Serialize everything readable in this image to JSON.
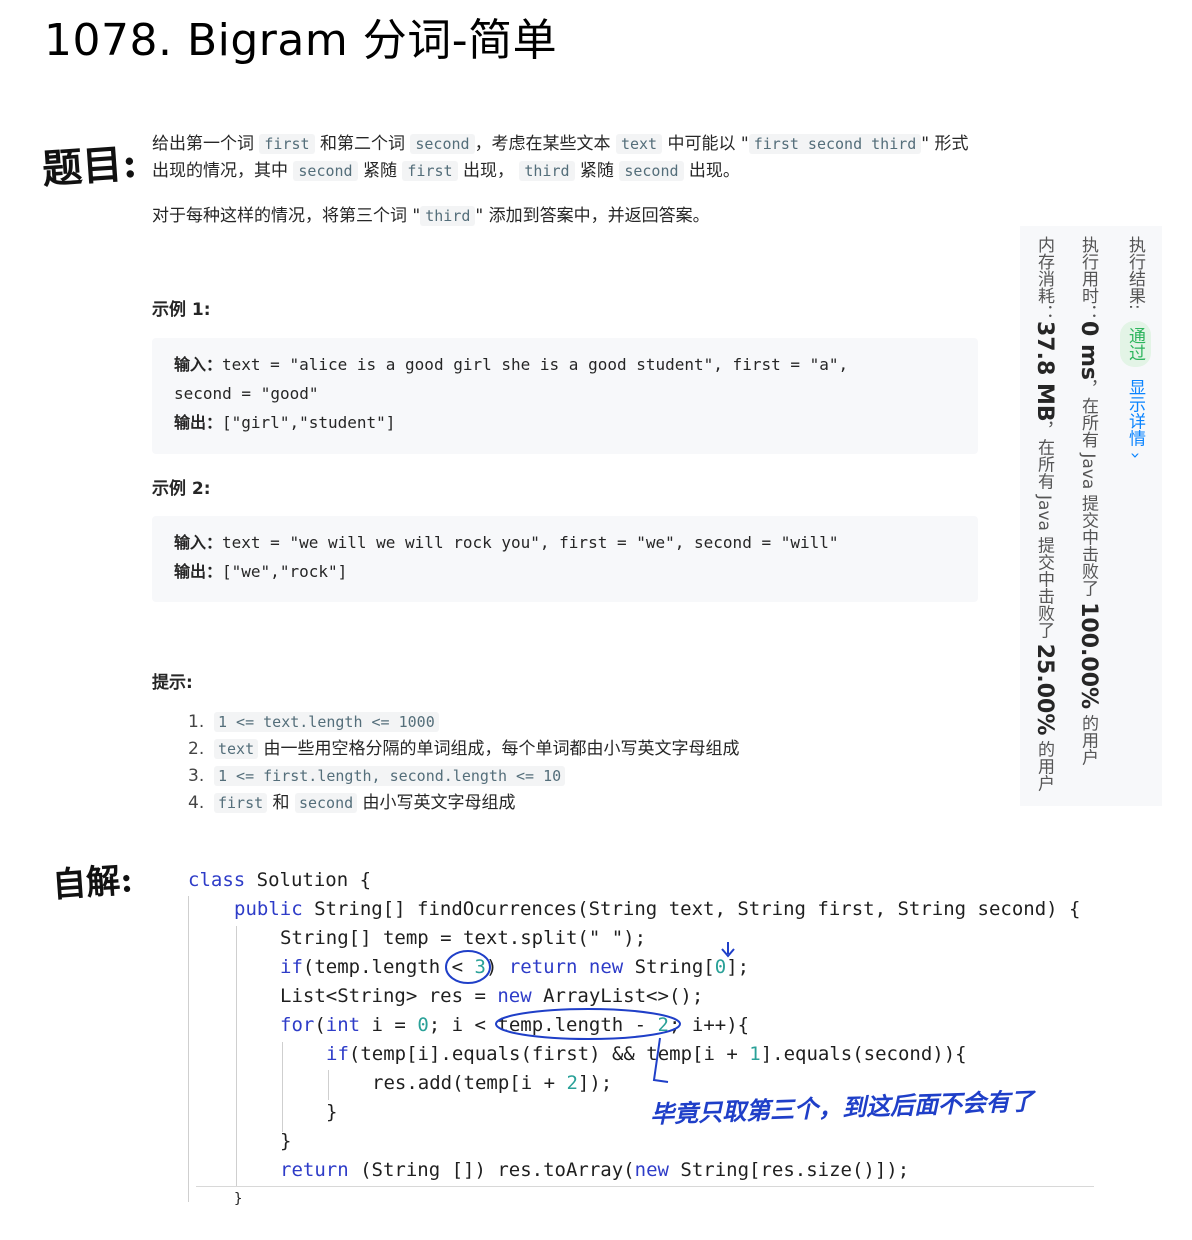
{
  "title": "1078. Bigram 分词-简单",
  "hw_labels": {
    "problem": "题目:",
    "solution": "自解:"
  },
  "statement": {
    "p1": {
      "t1": "给出第一个词 ",
      "c1": "first",
      "t2": " 和第二个词 ",
      "c2": "second",
      "t3": "，考虑在某些文本 ",
      "c3": "text",
      "t4": " 中可能以 \"",
      "c4": "first second third",
      "t5": "\" 形式出现的情况，其中 ",
      "c5": "second",
      "t6": " 紧随 ",
      "c6": "first",
      "t7": " 出现， ",
      "c7": "third",
      "t8": " 紧随 ",
      "c8": "second",
      "t9": " 出现。"
    },
    "p2": {
      "t1": "对于每种这样的情况，将第三个词 \"",
      "c1": "third",
      "t2": "\" 添加到答案中，并返回答案。"
    }
  },
  "examples": [
    {
      "label": "示例 1:",
      "input_label": "输入：",
      "input_line1": "text = \"alice is a good girl she is a good student\", first = \"a\",",
      "input_line2": "second = \"good\"",
      "output_label": "输出：",
      "output": "[\"girl\",\"student\"]"
    },
    {
      "label": "示例 2:",
      "input_label": "输入：",
      "input_line1": "text = \"we will we will rock you\", first = \"we\", second = \"will\"",
      "output_label": "输出：",
      "output": "[\"we\",\"rock\"]"
    }
  ],
  "hints": {
    "label": "提示:",
    "items": [
      {
        "num": "1.",
        "a": "1 <= text.length <= 1000",
        "b": "",
        "c": "",
        "d": ""
      },
      {
        "num": "2.",
        "a": "text",
        "b": " 由一些用空格分隔的单词组成，每个单词都由小写英文字母组成",
        "c": "",
        "d": ""
      },
      {
        "num": "3.",
        "a": "1 <= first.length, second.length <= 10",
        "b": "",
        "c": "",
        "d": ""
      },
      {
        "num": "4.",
        "a": "first",
        "b": " 和 ",
        "c": "second",
        "d": " 由小写英文字母组成"
      }
    ]
  },
  "result_panel": {
    "status_label": "执行结果:",
    "status": "通过",
    "detail": "显示详情 ›",
    "time_label": "执行用时：",
    "time_value": "0 ms",
    "time_text": "，在所有 Java 提交中击败了",
    "time_pct": "100.00%",
    "time_suffix": "的用户",
    "mem_label": "内存消耗：",
    "mem_value": "37.8 MB",
    "mem_text": "，在所有 Java 提交中击败了",
    "mem_pct": "25.00%",
    "mem_suffix": "的用户"
  },
  "code": {
    "l1a": "class",
    "l1b": " Solution {",
    "l2a": "public",
    "l2b": " String[] findOcurrences(String text, String first, String second) {",
    "l3": "String[] temp = text.split(\" \");",
    "l4a": "if",
    "l4b": "(temp.length < ",
    "l4c": "3",
    "l4d": ") ",
    "l4e": "return new",
    "l4f": " String[",
    "l4g": "0",
    "l4h": "];",
    "l5a": "List<String> res = ",
    "l5b": "new",
    "l5c": " ArrayList<>();",
    "l6a": "for",
    "l6b": "(",
    "l6c": "int",
    "l6d": " i = ",
    "l6e": "0",
    "l6f": "; i < temp.length - ",
    "l6g": "2",
    "l6h": "; i++){",
    "l7a": "if",
    "l7b": "(temp[i].equals(first) && temp[i + ",
    "l7c": "1",
    "l7d": "].equals(second)){",
    "l8a": "res.add(temp[i + ",
    "l8b": "2",
    "l8c": "]);",
    "l9": "}",
    "l10": "}",
    "l11a": "return",
    "l11b": " (String []) res.toArray(",
    "l11c": "new",
    "l11d": " String[res.size()]);",
    "l12": "}"
  },
  "annotation": "毕竟只取第三个，到这后面不会有了"
}
